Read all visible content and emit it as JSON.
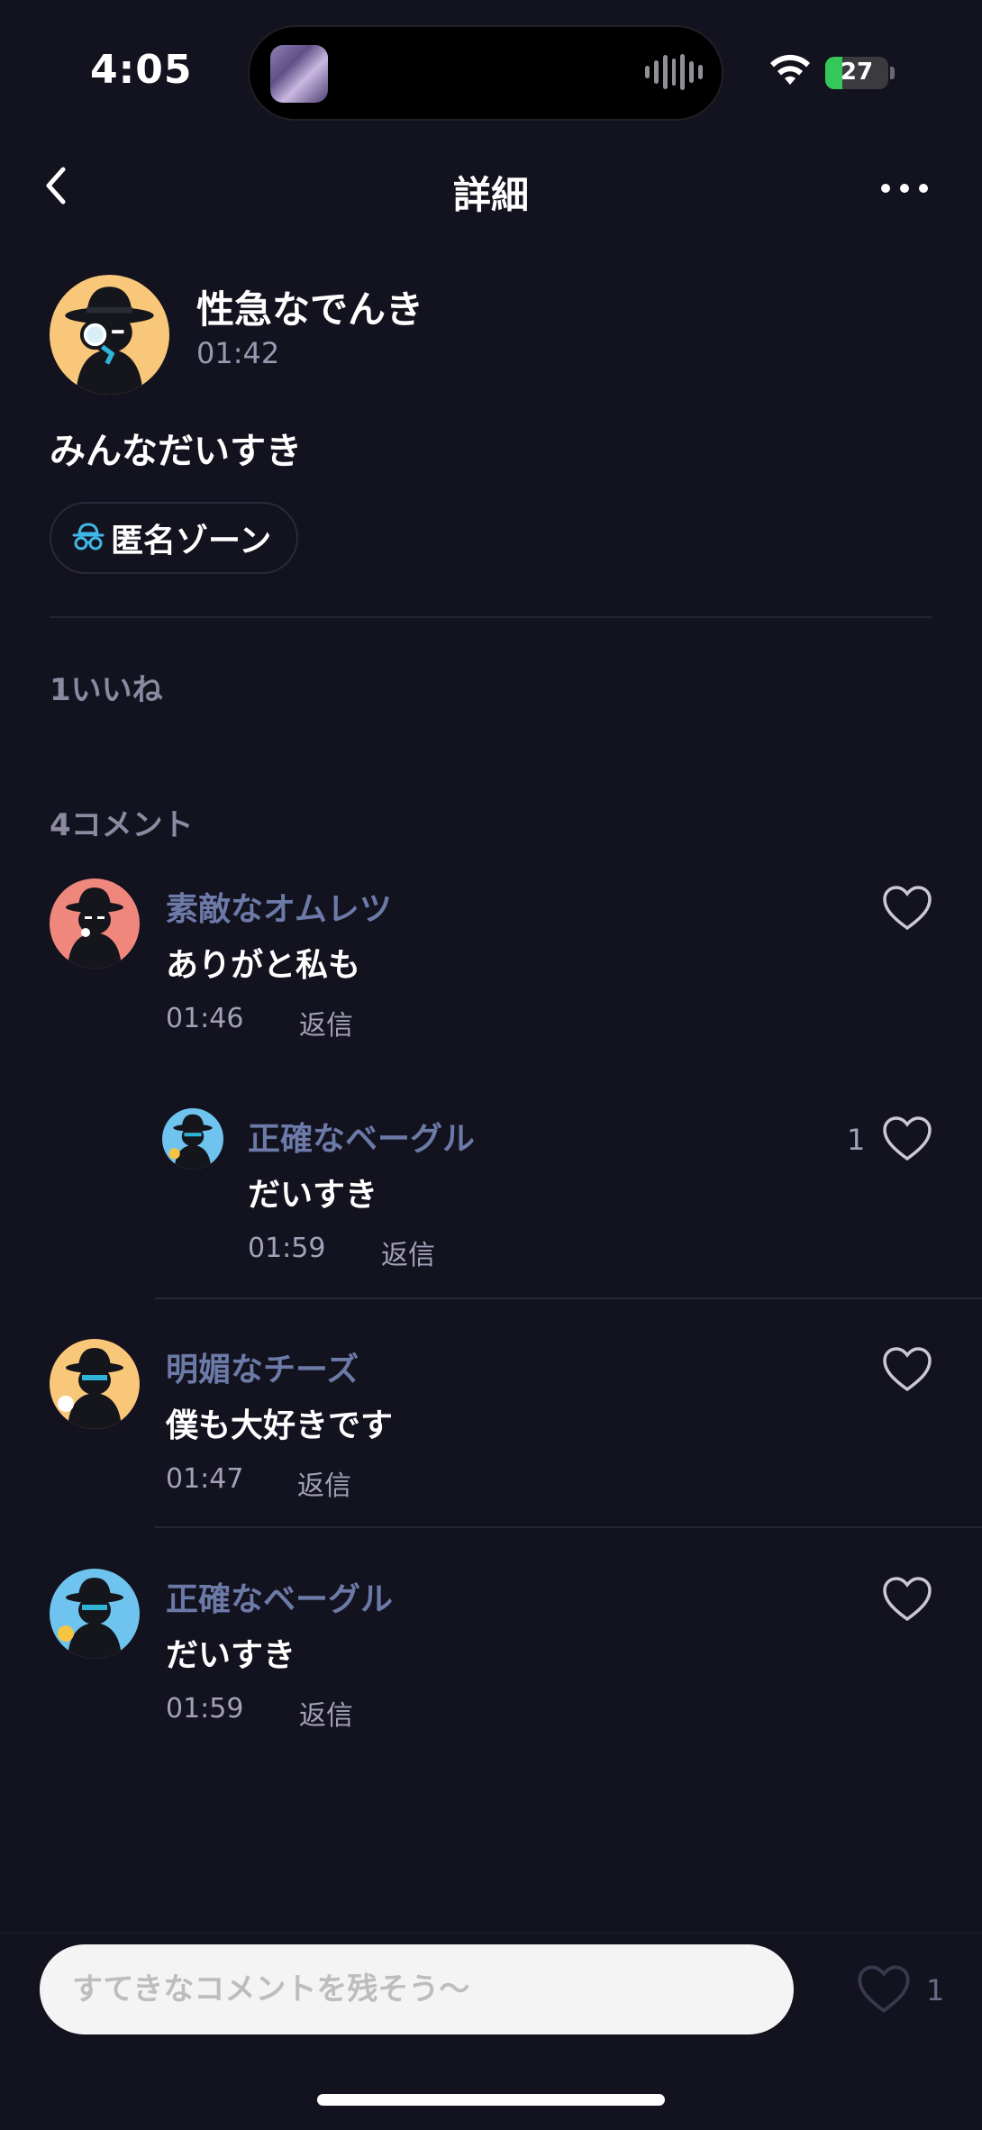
{
  "status_bar": {
    "time": "4:05",
    "battery": "27",
    "battery_level": 0.27
  },
  "nav": {
    "title": "詳細",
    "back_icon": "chevron-left-icon",
    "more_icon": "more-horizontal-icon"
  },
  "post": {
    "author": "性急なでんき",
    "time": "01:42",
    "body": "みんなだいすき",
    "zone_label": "匿名ゾーン",
    "avatar_bg": "#f9c779"
  },
  "likes": {
    "label": "1いいね"
  },
  "comments_header": {
    "label": "4コメント"
  },
  "comments": [
    {
      "name": "素敵なオムレツ",
      "text": "ありがと私も",
      "time": "01:46",
      "reply": "返信",
      "like_count": "",
      "avatar_bg": "#f0877c"
    },
    {
      "name": "正確なベーグル",
      "text": "だいすき",
      "time": "01:59",
      "reply": "返信",
      "like_count": "1",
      "avatar_bg": "#6ec4ee"
    },
    {
      "name": "明媚なチーズ",
      "text": "僕も大好きです",
      "time": "01:47",
      "reply": "返信",
      "like_count": "",
      "avatar_bg": "#f9c779"
    },
    {
      "name": "正確なベーグル",
      "text": "だいすき",
      "time": "01:59",
      "reply": "返信",
      "like_count": "",
      "avatar_bg": "#6ec4ee"
    }
  ],
  "bottom_bar": {
    "placeholder": "すてきなコメントを残そう〜",
    "like_count": "1"
  },
  "colors": {
    "background": "#13121f",
    "name_accent": "#6c7aa8",
    "zone_icon": "#3fb8e6",
    "battery": "#34c759"
  }
}
